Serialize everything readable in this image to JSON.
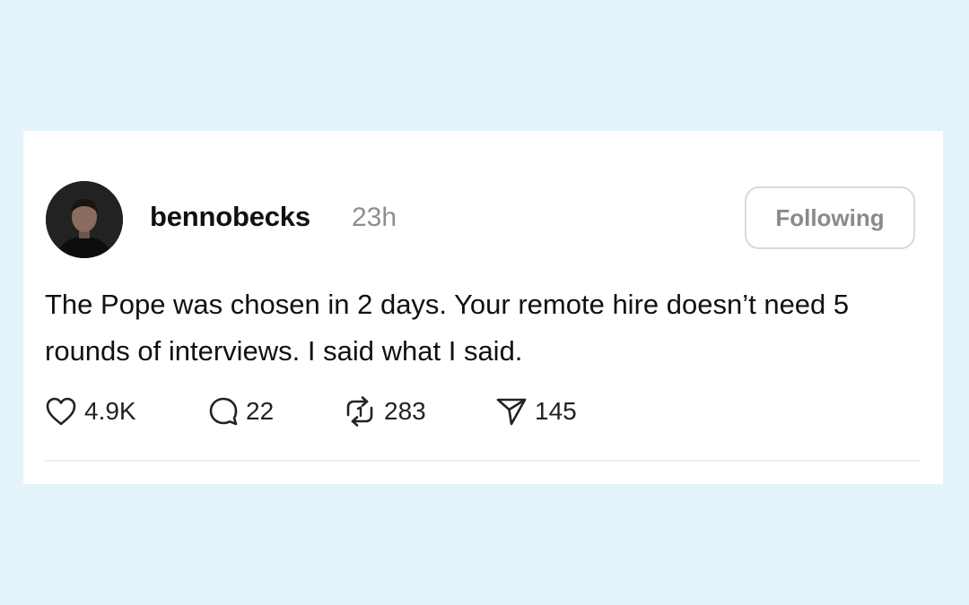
{
  "post": {
    "username": "bennobecks",
    "time": "23h",
    "follow_label": "Following",
    "text": "The Pope was chosen in 2 days. Your remote hire doesn’t need 5 rounds of interviews. I said what I said.",
    "actions": {
      "likes": "4.9K",
      "replies": "22",
      "reposts": "283",
      "shares": "145"
    }
  },
  "icons": {
    "like": "heart-icon",
    "reply": "speech-bubble-icon",
    "repost": "repost-icon",
    "share": "paper-plane-icon"
  },
  "colors": {
    "background": "#e2f3fa",
    "card": "#ffffff",
    "text": "#111111",
    "muted": "#8e8e8e",
    "button_border": "#d9d9d9"
  }
}
